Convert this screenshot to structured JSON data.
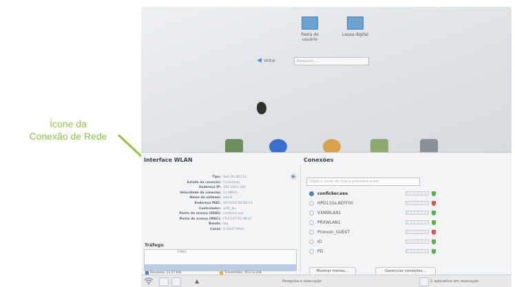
{
  "annotation": {
    "line1": "Ícone da",
    "line2": "Conexão de Rede"
  },
  "desktop": {
    "icons": [
      {
        "label_line1": "Pasta do",
        "label_line2": "usuário",
        "icon": "folder-icon"
      },
      {
        "label_line1": "Lousa digital",
        "label_line2": "",
        "icon": "monitor-icon"
      }
    ],
    "back_label": "Voltar",
    "search_placeholder": "Pesquisar..."
  },
  "wlan": {
    "title": "Interface WLAN",
    "info": [
      {
        "key": "Tipo:",
        "value": "Sem fio 802.11"
      },
      {
        "key": "Estado da conexão:",
        "value": "Conectado"
      },
      {
        "key": "Endereço IP:",
        "value": "192.168.1.164"
      },
      {
        "key": "Velocidade da conexão:",
        "value": "11 MBit/s"
      },
      {
        "key": "Nome do sistema:",
        "value": "wlan0"
      },
      {
        "key": "Endereço MAC:",
        "value": "90:F6:52:06:BD:A3"
      },
      {
        "key": "Controlador:",
        "value": "ar5k_lku"
      },
      {
        "key": "Ponto de acesso (SSID):",
        "value": "conficker.exe"
      },
      {
        "key": "Ponto de acesso (MAC):",
        "value": "F0:13:E7:E1:08:2C"
      },
      {
        "key": "Banda:",
        "value": "b/g"
      },
      {
        "key": "Canal:",
        "value": "6 (2437 MHz)"
      }
    ],
    "traffic_label": "Tráfego",
    "graph_label": "3 Kb/s",
    "received": "Recebido: 13.07 KiB",
    "transmitted": "Transmitido: 453.52 KiB"
  },
  "connections": {
    "title": "Conexões",
    "search_placeholder": "Digite o nome da rede e pressione enter",
    "items": [
      {
        "name": "conficker.exe",
        "active": true,
        "shield": "green"
      },
      {
        "name": "HPD110a.8EFF00",
        "active": false,
        "shield": "red"
      },
      {
        "name": "VXNWLAN1",
        "active": false,
        "shield": "green"
      },
      {
        "name": "PRXWLAN1",
        "active": false,
        "shield": "green"
      },
      {
        "name": "Proxxon_GUEST",
        "active": false,
        "shield": "red"
      },
      {
        "name": "IO",
        "active": false,
        "shield": "green"
      },
      {
        "name": "PD",
        "active": false,
        "shield": "green"
      }
    ],
    "show_more": "Mostrar menos...",
    "manage": "Gerenciar conexões..."
  },
  "taskbar": {
    "search_label": "Pesquisa e execução",
    "apps_running": "1 aplicativo em execução"
  },
  "colors": {
    "annotation": "#8cc63f",
    "accent": "#4a7fc0",
    "shield_green": "#55b346",
    "shield_red": "#d9534f"
  }
}
